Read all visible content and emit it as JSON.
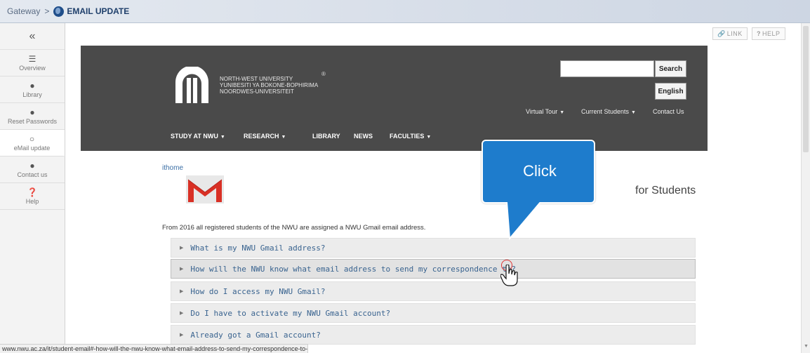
{
  "breadcrumb": {
    "root": "Gateway",
    "separator": ">",
    "current": "EMAIL UPDATE"
  },
  "sidebar": {
    "collapse_glyph": "«",
    "items": [
      {
        "label": "Overview",
        "icon": "list-icon"
      },
      {
        "label": "Library",
        "icon": "globe-icon"
      },
      {
        "label": "Reset Passwords",
        "icon": "globe-icon"
      },
      {
        "label": "eMail update",
        "icon": "globe-icon",
        "active": true
      },
      {
        "label": "Contact us",
        "icon": "globe-icon"
      },
      {
        "label": "Help",
        "icon": "help-icon"
      }
    ]
  },
  "toolbar": {
    "link_label": "LINK",
    "help_label": "HELP"
  },
  "header": {
    "logo_lines": [
      "NORTH-WEST UNIVERSITY",
      "YUNIBESITI YA BOKONE-BOPHIRIMA",
      "NOORDWES-UNIVERSITEIT"
    ],
    "registered": "®",
    "search_label": "Search",
    "language_label": "English",
    "utility_links": [
      "Virtual Tour",
      "Current Students",
      "Contact Us"
    ],
    "main_nav": [
      "STUDY AT NWU",
      "RESEARCH",
      "LIBRARY",
      "NEWS",
      "FACULTIES"
    ]
  },
  "content": {
    "ithome": "ithome",
    "for_students": "for Students",
    "intro": "From 2016 all registered students of the NWU are assigned a NWU Gmail email address.",
    "faqs": [
      "What is my NWU Gmail address?",
      "How will the NWU know what email address to send my correspondence to?",
      "How do I access my NWU Gmail?",
      "Do I have to activate my NWU Gmail account?",
      "Already got a Gmail account?"
    ]
  },
  "callout": {
    "label": "Click"
  },
  "status_url": "www.nwu.ac.za/it/student-email#-how-will-the-nwu-know-what-email-address-to-send-my-correspondence-to-",
  "colors": {
    "header_bg": "#4a4a4a",
    "callout": "#1e7ccc",
    "link": "#39638f",
    "gmail_red": "#d93025"
  }
}
